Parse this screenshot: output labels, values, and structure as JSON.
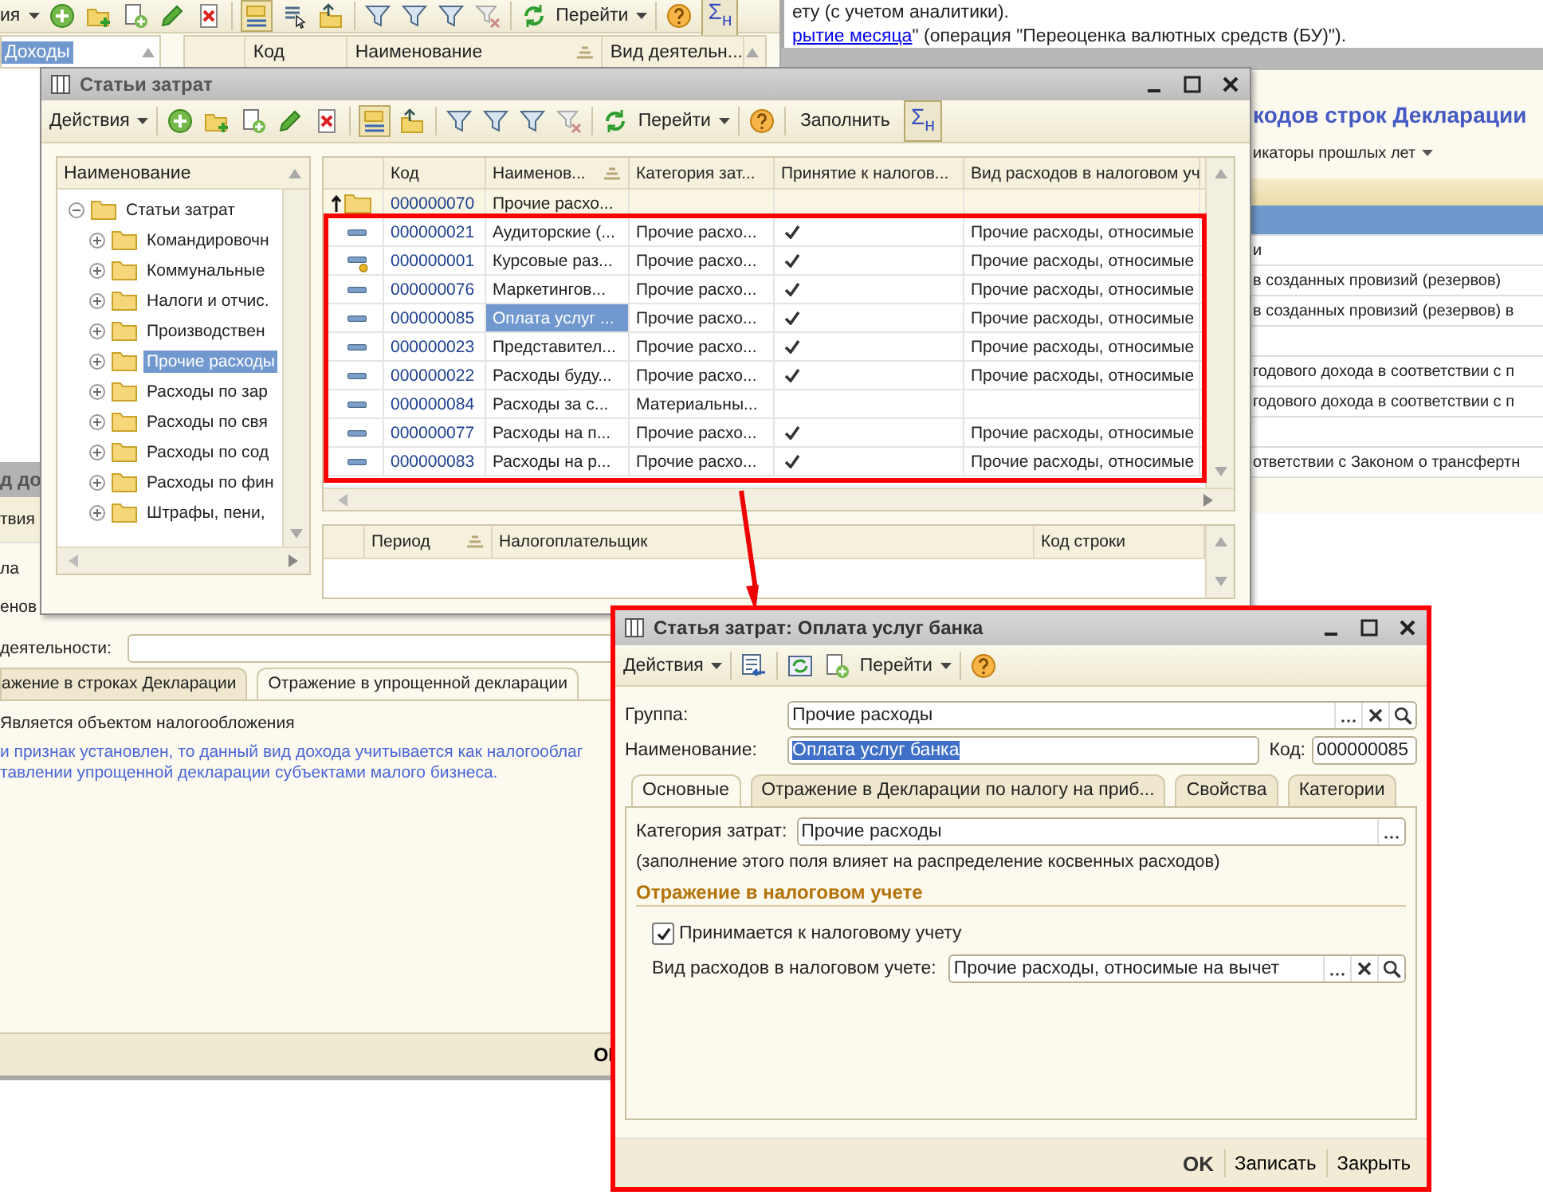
{
  "background_list_window": {
    "toolbar": {
      "actions": "ия",
      "goto": "Перейти",
      "sum": "Σ$_{н}$"
    },
    "tree": {
      "items": [
        {
          "label": "Доходы",
          "selected": true
        }
      ]
    },
    "table": {
      "columns": [
        "Код",
        "Наименование",
        "Вид деятельн..."
      ]
    }
  },
  "document": {
    "line_1": "ету (с учетом аналитики).",
    "link": "рытие месяца",
    "line_2_rest": "\" (операция \"Переоценка валютных средств (БУ)\")."
  },
  "declaration_window": {
    "title": "кодов строк Декларации",
    "filter": "икаторы прошлых лет",
    "rows": [
      {
        "selected": true
      },
      {
        "text": "и",
        "selected": false
      },
      {
        "text": "в созданных провизий (резервов)",
        "selected": false
      },
      {
        "text": "в созданных провизий (резервов) в",
        "selected": false
      },
      {
        "selected": false
      },
      {
        "text": "годового дохода в соответствии с п",
        "selected": false
      },
      {
        "text": "годового дохода в соответствии с п",
        "selected": false
      },
      {
        "selected": false
      },
      {
        "text": "ответствии с Законом о трансфертн",
        "selected": false
      }
    ]
  },
  "income_form": {
    "title": "д до",
    "toolbar_label": "твия",
    "label_1": "ла",
    "label_2": "енов",
    "activity_label": "деятельности:",
    "tabs": [
      {
        "label": "ажение в строках Декларации",
        "selected": false
      },
      {
        "label": "Отражение в упрощенной декларации",
        "selected": true
      }
    ],
    "taxable_label": "Является объектом налогообложения",
    "hint": "и признак установлен, то данный вид дохода учитывается как налогооблаг\nтавлении упрощенной декларации субъектами малого бизнеса.",
    "ok_label": "OI"
  },
  "cost_items_window": {
    "title": "Статьи затрат",
    "toolbar": {
      "actions": "Действия",
      "goto": "Перейти",
      "fill": "Заполнить",
      "sum": "Σ$_{н}$"
    },
    "tree": {
      "column": "Наименование",
      "items": [
        {
          "label": "Статьи затрат",
          "expanded": true,
          "selected": false,
          "children": [
            {
              "label": "Командировочн",
              "expanded": false,
              "selected": false
            },
            {
              "label": "Коммунальные",
              "expanded": false,
              "selected": false
            },
            {
              "label": "Налоги и отчис.",
              "expanded": false,
              "selected": false
            },
            {
              "label": "Производствен",
              "expanded": false,
              "selected": false
            },
            {
              "label": "Прочие расходы",
              "expanded": false,
              "selected": true
            },
            {
              "label": "Расходы по зар",
              "expanded": false,
              "selected": false
            },
            {
              "label": "Расходы по свя",
              "expanded": false,
              "selected": false
            },
            {
              "label": "Расходы по сод",
              "expanded": false,
              "selected": false
            },
            {
              "label": "Расходы по фин",
              "expanded": false,
              "selected": false
            },
            {
              "label": "Штрафы, пени,",
              "expanded": false,
              "selected": false
            }
          ]
        }
      ]
    },
    "table": {
      "columns": [
        "Код",
        "Наименов...",
        "Категория зат...",
        "Принятие к налогов...",
        "Вид расходов в налоговом уч"
      ],
      "rows": [
        {
          "kind": "group",
          "code": "000000070",
          "name": "Прочие расхо...",
          "selected": false
        },
        {
          "kind": "item",
          "code": "000000021",
          "name": "Аудиторские (...",
          "category": "Прочие расхо...",
          "accepted": true,
          "expense_type": "Прочие расходы, относимые",
          "selected": false
        },
        {
          "kind": "predefined",
          "code": "000000001",
          "name": "Курсовые раз...",
          "category": "Прочие расхо...",
          "accepted": true,
          "expense_type": "Прочие расходы, относимые",
          "selected": false
        },
        {
          "kind": "item",
          "code": "000000076",
          "name": "Маркетингов...",
          "category": "Прочие расхо...",
          "accepted": true,
          "expense_type": "Прочие расходы, относимые",
          "selected": false
        },
        {
          "kind": "item",
          "code": "000000085",
          "name": "Оплата услуг ...",
          "category": "Прочие расхо...",
          "accepted": true,
          "expense_type": "Прочие расходы, относимые",
          "selected": true
        },
        {
          "kind": "item",
          "code": "000000023",
          "name": "Представител...",
          "category": "Прочие расхо...",
          "accepted": true,
          "expense_type": "Прочие расходы, относимые",
          "selected": false
        },
        {
          "kind": "item",
          "code": "000000022",
          "name": "Расходы буду...",
          "category": "Прочие расхо...",
          "accepted": true,
          "expense_type": "Прочие расходы, относимые",
          "selected": false
        },
        {
          "kind": "item",
          "code": "000000084",
          "name": "Расходы за с...",
          "category": "Материальны...",
          "selected": false
        },
        {
          "kind": "item",
          "code": "000000077",
          "name": "Расходы на п...",
          "category": "Прочие расхо...",
          "accepted": true,
          "expense_type": "Прочие расходы, относимые",
          "selected": false
        },
        {
          "kind": "item",
          "code": "000000083",
          "name": "Расходы на р...",
          "category": "Прочие расхо...",
          "accepted": true,
          "expense_type": "Прочие расходы, относимые",
          "selected": false
        }
      ]
    },
    "history_table": {
      "columns": [
        "Период",
        "Налогоплательщик",
        "Код строки"
      ]
    }
  },
  "item_dialog": {
    "title": "Статья затрат: Оплата услуг банка",
    "toolbar": {
      "actions": "Действия",
      "goto": "Перейти"
    },
    "group": {
      "label": "Группа:",
      "value": "Прочие расходы"
    },
    "name": {
      "label": "Наименование:",
      "value": "Оплата услуг банка",
      "text_selected": true
    },
    "code": {
      "label": "Код:",
      "value": "000000085"
    },
    "tabs": [
      {
        "label": "Основные",
        "selected": true
      },
      {
        "label": "Отражение в Декларации по налогу на приб...",
        "selected": false
      },
      {
        "label": "Свойства",
        "selected": false
      },
      {
        "label": "Категории",
        "selected": false
      }
    ],
    "category": {
      "label": "Категория затрат:",
      "value": "Прочие расходы"
    },
    "note": "(заполнение этого поля влияет на распределение косвенных расходов)",
    "section_title": "Отражение в налоговом учете",
    "tax_accepted": {
      "label": "Принимается к налоговому учету",
      "checked": true
    },
    "expense_type": {
      "label": "Вид расходов в налоговом учете:",
      "value": "Прочие расходы, относимые на вычет"
    },
    "buttons": [
      {
        "label": "OK",
        "default": true
      },
      {
        "label": "Записать",
        "default": false
      },
      {
        "label": "Закрыть",
        "default": false
      }
    ]
  }
}
